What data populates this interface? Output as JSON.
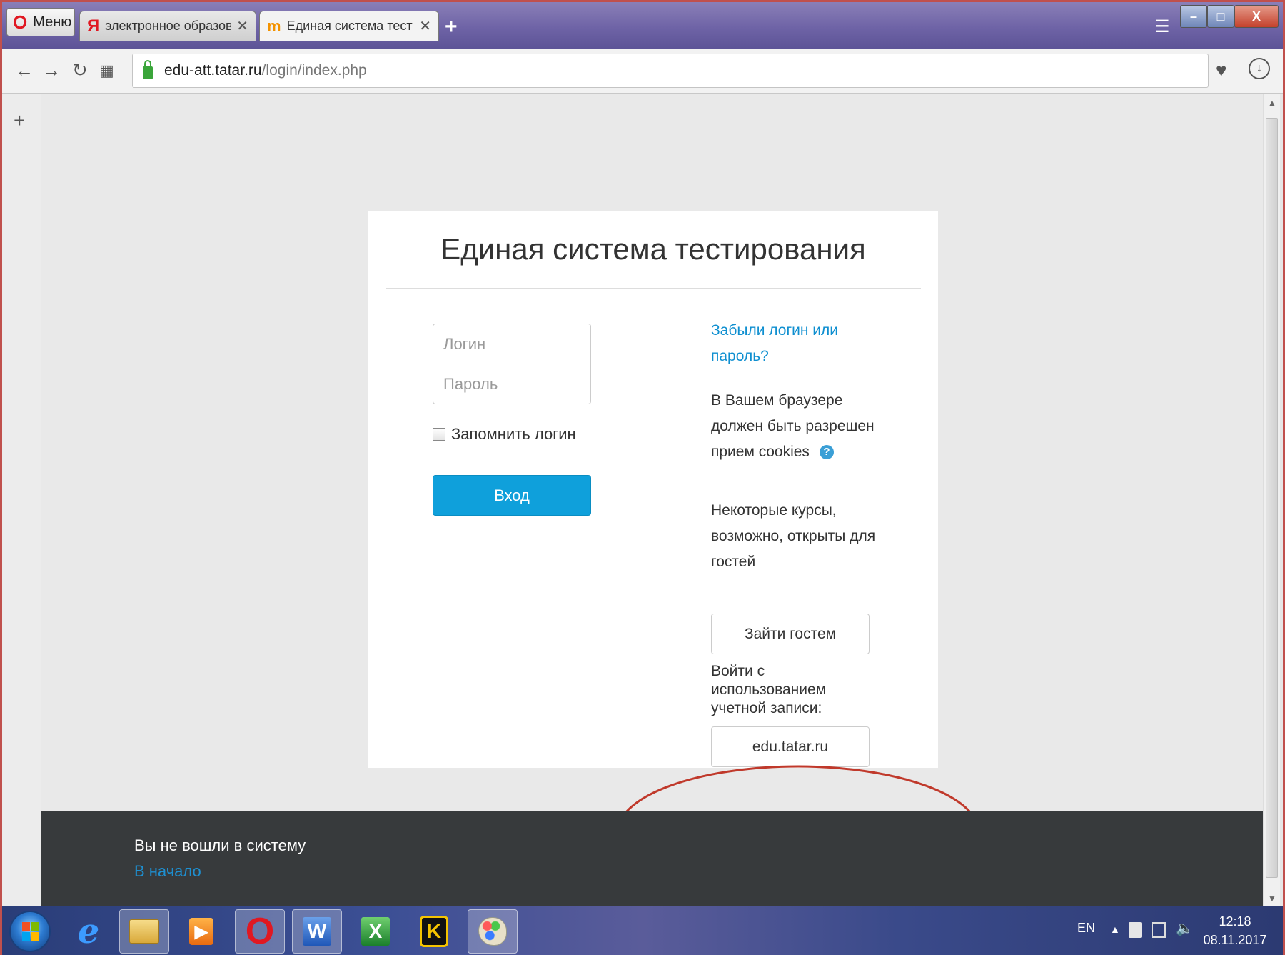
{
  "browser": {
    "menu_label": "Меню",
    "tabs": [
      {
        "title": "электронное образовани",
        "active": false
      },
      {
        "title": "Единая система тестиров",
        "active": true
      }
    ],
    "url_host": "edu-att.tatar.ru",
    "url_path": "/login/index.php"
  },
  "login_page": {
    "title": "Единая система тестирования",
    "login_placeholder": "Логин",
    "password_placeholder": "Пароль",
    "remember_label": "Запомнить логин",
    "submit_label": "Вход",
    "forgot_link": "Забыли логин или пароль?",
    "cookies_text": "В Вашем браузере должен быть разрешен прием cookies",
    "guests_text": "Некоторые курсы, возможно, открыты для гостей",
    "guest_button": "Зайти гостем",
    "login_with_text": "Войти с использованием учетной записи:",
    "sso_button": "edu.tatar.ru"
  },
  "footer": {
    "status": "Вы не вошли в систему",
    "home_link": "В начало"
  },
  "taskbar": {
    "language": "EN",
    "time": "12:18",
    "date": "08.11.2017"
  },
  "colors": {
    "primary_button": "#0fa0db",
    "link": "#0f8fd0",
    "annotation_ellipse": "#c0392b",
    "footer_bg": "#373a3c"
  },
  "icons": [
    "opera-icon",
    "yandex-icon",
    "moodle-icon",
    "close-icon",
    "plus-icon",
    "back-icon",
    "forward-icon",
    "reload-icon",
    "speed-dial-icon",
    "lock-icon",
    "heart-icon",
    "download-icon",
    "help-icon",
    "windows-start-icon",
    "ie-icon",
    "folder-icon",
    "media-player-icon",
    "word-icon",
    "excel-icon",
    "k-app-icon",
    "paint-icon",
    "volume-icon",
    "network-icon",
    "flag-icon"
  ]
}
